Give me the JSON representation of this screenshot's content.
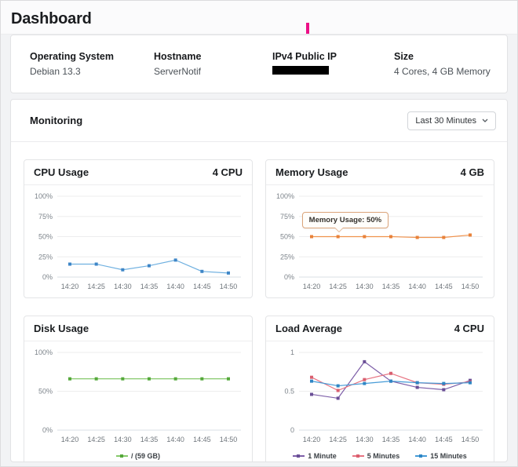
{
  "page": {
    "title": "Dashboard"
  },
  "accent_colors": {
    "pink_marker": "#ec1087",
    "redacted_bar": "#000000",
    "tooltip_border": "#dba47a"
  },
  "info_card": {
    "fields": [
      {
        "label": "Operating System",
        "value": "Debian 13.3",
        "redacted": false
      },
      {
        "label": "Hostname",
        "value": "ServerNotif",
        "redacted": false
      },
      {
        "label": "IPv4 Public IP",
        "value": "",
        "redacted": true
      },
      {
        "label": "Size",
        "value": "4 Cores, 4 GB Memory",
        "redacted": false
      }
    ]
  },
  "monitoring": {
    "title": "Monitoring",
    "range_selector": {
      "value": "Last 30 Minutes",
      "icon": "chevron-down-icon"
    },
    "x_categories": [
      "14:20",
      "14:25",
      "14:30",
      "14:35",
      "14:40",
      "14:45",
      "14:50"
    ],
    "charts": [
      {
        "id": "cpu-usage",
        "title": "CPU Usage",
        "unit_label": "4 CPU",
        "type": "line",
        "ylim": [
          0,
          100
        ],
        "grid": true,
        "show_legend": false,
        "y_ticks": [
          {
            "value": 0,
            "label": "0%"
          },
          {
            "value": 25,
            "label": "25%"
          },
          {
            "value": 50,
            "label": "50%"
          },
          {
            "value": 75,
            "label": "75%"
          },
          {
            "value": 100,
            "label": "100%"
          }
        ],
        "series": [
          {
            "name": "CPU",
            "color": "#6fb0e0",
            "marker_color": "#3e86c7",
            "values": [
              16,
              16,
              9,
              14,
              21,
              7,
              5
            ]
          }
        ]
      },
      {
        "id": "memory-usage",
        "title": "Memory Usage",
        "unit_label": "4 GB",
        "type": "line",
        "ylim": [
          0,
          100
        ],
        "grid": true,
        "show_legend": false,
        "y_ticks": [
          {
            "value": 0,
            "label": "0%"
          },
          {
            "value": 25,
            "label": "25%"
          },
          {
            "value": 50,
            "label": "50%"
          },
          {
            "value": 75,
            "label": "75%"
          },
          {
            "value": 100,
            "label": "100%"
          }
        ],
        "series": [
          {
            "name": "Memory",
            "color": "#f0924d",
            "marker_color": "#e8823a",
            "values": [
              50,
              50,
              50,
              50,
              49,
              49,
              52
            ]
          }
        ],
        "tooltip": {
          "text": "Memory Usage: 50%",
          "point_index": 1
        }
      },
      {
        "id": "disk-usage",
        "title": "Disk Usage",
        "unit_label": "",
        "type": "line",
        "ylim": [
          0,
          100
        ],
        "grid": true,
        "show_legend": true,
        "y_ticks": [
          {
            "value": 0,
            "label": "0%"
          },
          {
            "value": 50,
            "label": "50%"
          },
          {
            "value": 100,
            "label": "100%"
          }
        ],
        "series": [
          {
            "name": "/ (59 GB)",
            "color": "#86c96b",
            "marker_color": "#55a83b",
            "values": [
              66,
              66,
              66,
              66,
              66,
              66,
              66
            ]
          }
        ]
      },
      {
        "id": "load-average",
        "title": "Load Average",
        "unit_label": "4 CPU",
        "type": "line",
        "ylim": [
          0,
          1
        ],
        "grid": true,
        "show_legend": true,
        "y_ticks": [
          {
            "value": 0,
            "label": "0"
          },
          {
            "value": 0.5,
            "label": "0.5"
          },
          {
            "value": 1,
            "label": "1"
          }
        ],
        "series": [
          {
            "name": "1 Minute",
            "color": "#7d5ea8",
            "marker_color": "#6a4f96",
            "values": [
              0.46,
              0.41,
              0.88,
              0.63,
              0.55,
              0.52,
              0.64
            ]
          },
          {
            "name": "5 Minutes",
            "color": "#e77381",
            "marker_color": "#d95f6f",
            "values": [
              0.68,
              0.51,
              0.65,
              0.73,
              0.61,
              0.59,
              0.62
            ]
          },
          {
            "name": "15 Minutes",
            "color": "#469bd7",
            "marker_color": "#2f86c4",
            "values": [
              0.63,
              0.57,
              0.6,
              0.63,
              0.61,
              0.6,
              0.61
            ]
          }
        ]
      }
    ]
  }
}
